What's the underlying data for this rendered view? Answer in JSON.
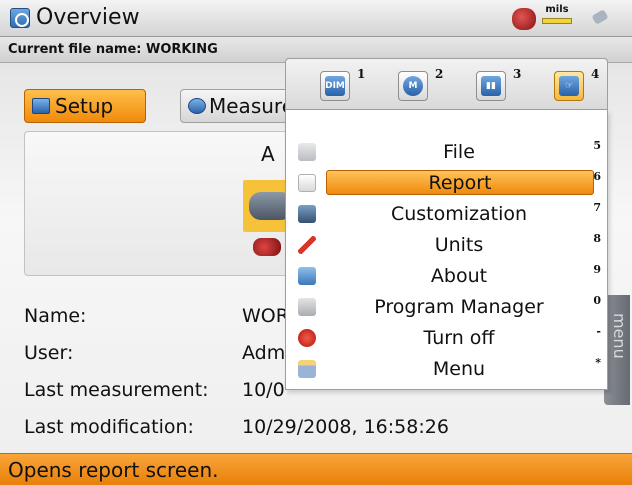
{
  "header": {
    "title": "Overview",
    "units": "mils",
    "title_icon": "overview-icon",
    "status_icons": [
      "motor-status-icon",
      "units-ruler-icon",
      "power-plug-icon"
    ]
  },
  "file_bar": {
    "text": "Current file name: WORKING"
  },
  "main": {
    "setup_label": "Setup",
    "measure_label": "Measure",
    "preview_letter": "A",
    "info": [
      {
        "label": "Name:",
        "value": "WOR"
      },
      {
        "label": "User:",
        "value": "Adm"
      },
      {
        "label": "Last measurement:",
        "value": "10/0"
      },
      {
        "label": "Last modification:",
        "value": "10/29/2008, 16:58:26"
      }
    ]
  },
  "menu": {
    "tabs": [
      {
        "icon": "dim-icon",
        "glyph": "DIM",
        "number": "1"
      },
      {
        "icon": "measure-circle-icon",
        "glyph": "M",
        "number": "2"
      },
      {
        "icon": "coupling-icon",
        "glyph": "▮▮",
        "number": "3"
      },
      {
        "icon": "hand-menu-icon",
        "glyph": "☞",
        "number": "4"
      }
    ],
    "items": [
      {
        "label": "File",
        "key": "5",
        "icon": "file-icon"
      },
      {
        "label": "Report",
        "key": "6",
        "icon": "report-icon"
      },
      {
        "label": "Customization",
        "key": "7",
        "icon": "customization-icon"
      },
      {
        "label": "Units",
        "key": "8",
        "icon": "units-thermometer-icon"
      },
      {
        "label": "About",
        "key": "9",
        "icon": "about-icon"
      },
      {
        "label": "Program Manager",
        "key": "0",
        "icon": "program-manager-icon"
      },
      {
        "label": "Turn off",
        "key": "-",
        "icon": "power-icon"
      },
      {
        "label": "Menu",
        "key": "*",
        "icon": "menu-icon"
      }
    ],
    "selected_index": 1,
    "side_tab_label": "menu"
  },
  "status": {
    "text": "Opens report screen."
  },
  "colors": {
    "accent_orange": "#f08a0c",
    "selection_orange": "#f6a534",
    "icon_blue": "#2a61a9"
  }
}
